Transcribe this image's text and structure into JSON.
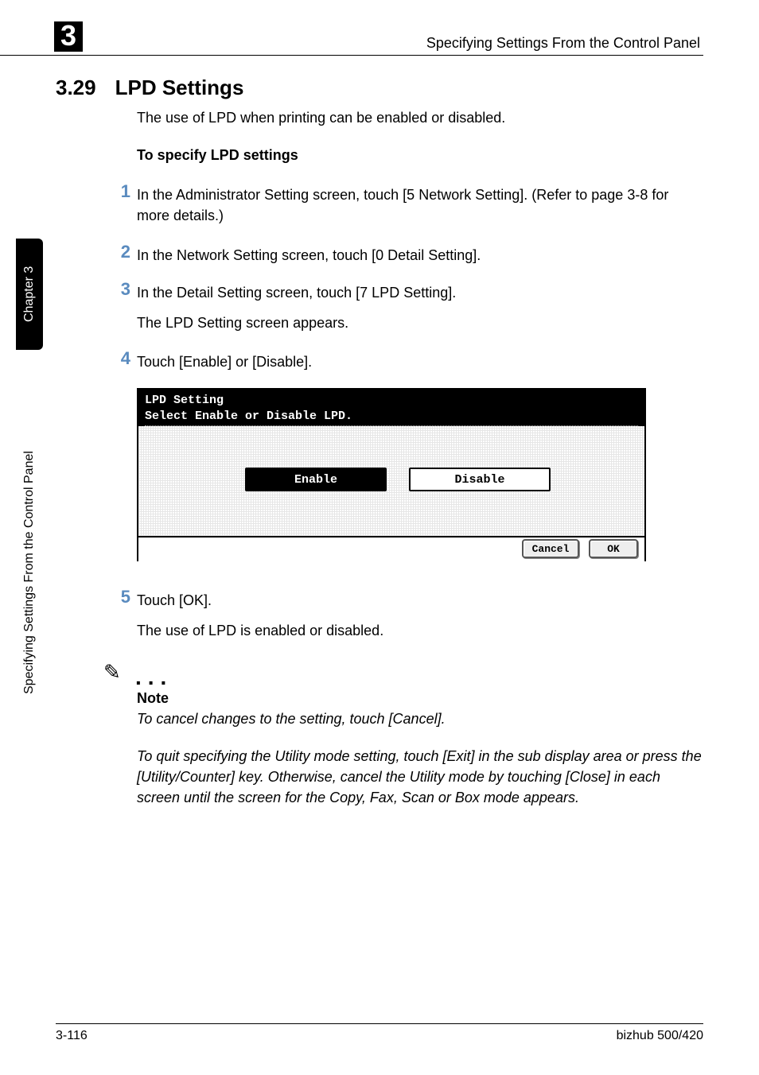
{
  "header": {
    "chapter_badge": "3",
    "running_title": "Specifying Settings From the Control Panel"
  },
  "section": {
    "number": "3.29",
    "title": "LPD Settings"
  },
  "intro": "The use of LPD when printing can be enabled or disabled.",
  "subheading": "To specify LPD settings",
  "steps": {
    "s1": "In the Administrator Setting screen, touch [5 Network Setting]. (Refer to page 3-8 for more details.)",
    "s2": "In the Network Setting screen, touch [0 Detail Setting].",
    "s3": "In the Detail Setting screen, touch [7 LPD Setting].",
    "s3_sub": "The LPD Setting screen appears.",
    "s4": "Touch [Enable] or [Disable].",
    "s5": "Touch [OK].",
    "s5_sub": "The use of LPD is enabled or disabled."
  },
  "step_numbers": {
    "n1": "1",
    "n2": "2",
    "n3": "3",
    "n4": "4",
    "n5": "5"
  },
  "panel": {
    "title_line1": "LPD Setting",
    "title_line2": "Select Enable or Disable LPD.",
    "btn_enable": "Enable",
    "btn_disable": "Disable",
    "btn_cancel": "Cancel",
    "btn_ok": "OK"
  },
  "note": {
    "icon": "✎",
    "dots": "...",
    "label": "Note",
    "text1": "To cancel changes to the setting, touch [Cancel].",
    "text2": "To quit specifying the Utility mode setting, touch [Exit] in the sub display area or press the [Utility/Counter] key. Otherwise, cancel the Utility mode by touching [Close] in each screen until the screen for the Copy, Fax, Scan or Box mode appears."
  },
  "side": {
    "chapter": "Chapter 3",
    "label": "Specifying Settings From the Control Panel"
  },
  "footer": {
    "page": "3-116",
    "product": "bizhub 500/420"
  }
}
